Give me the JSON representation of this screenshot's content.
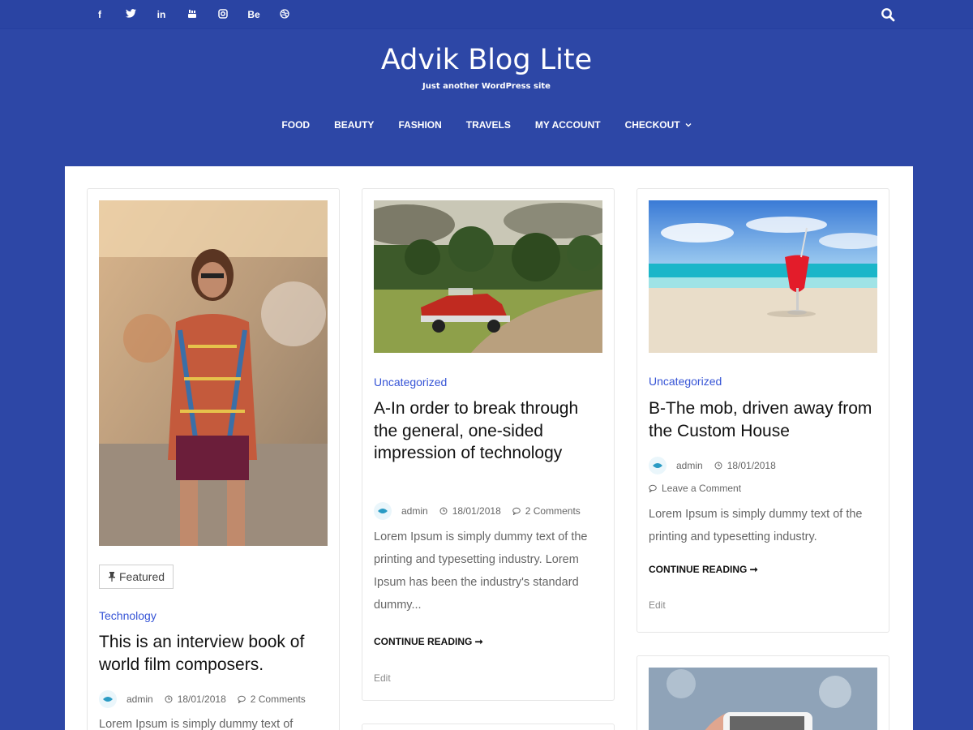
{
  "social": {
    "items": [
      {
        "icon": "facebook-icon",
        "glyph": "f"
      },
      {
        "icon": "twitter-icon",
        "glyph": "🐦"
      },
      {
        "icon": "linkedin-icon",
        "glyph": "in"
      },
      {
        "icon": "youtube-icon",
        "glyph": "▶"
      },
      {
        "icon": "instagram-icon",
        "glyph": "◎"
      },
      {
        "icon": "behance-icon",
        "glyph": "Be"
      },
      {
        "icon": "dribbble-icon",
        "glyph": "⊛"
      }
    ]
  },
  "site": {
    "title": "Advik Blog Lite",
    "tagline": "Just another WordPress site"
  },
  "nav": {
    "items": [
      "FOOD",
      "BEAUTY",
      "FASHION",
      "TRAVELS",
      "MY ACCOUNT",
      "CHECKOUT"
    ]
  },
  "posts": [
    {
      "featured": "Featured",
      "category": "Technology",
      "title": "This is an interview book of world film composers.",
      "author": "admin",
      "date": "18/01/2018",
      "comments": "2 Comments",
      "excerpt": "Lorem Ipsum is simply dummy text of"
    },
    {
      "category": "Uncategorized",
      "title": "A-In order to break through the general, one-sided impression of technology",
      "author": "admin",
      "date": "18/01/2018",
      "comments": "2 Comments",
      "excerpt": "Lorem Ipsum is simply dummy text of the printing and typesetting industry. Lorem Ipsum has been the industry's standard dummy...",
      "more": "CONTINUE READING ➞",
      "edit": "Edit"
    },
    {
      "category": "Uncategorized",
      "title": "B-The mob, driven away from the Custom House",
      "author": "admin",
      "date": "18/01/2018",
      "comments": "Leave a Comment",
      "excerpt": "Lorem Ipsum is simply dummy text of the printing and typesetting industry.",
      "more": "CONTINUE READING ➞",
      "edit": "Edit"
    }
  ],
  "colors": {
    "brand": "#2d47a6",
    "accent": "#3654d6"
  }
}
